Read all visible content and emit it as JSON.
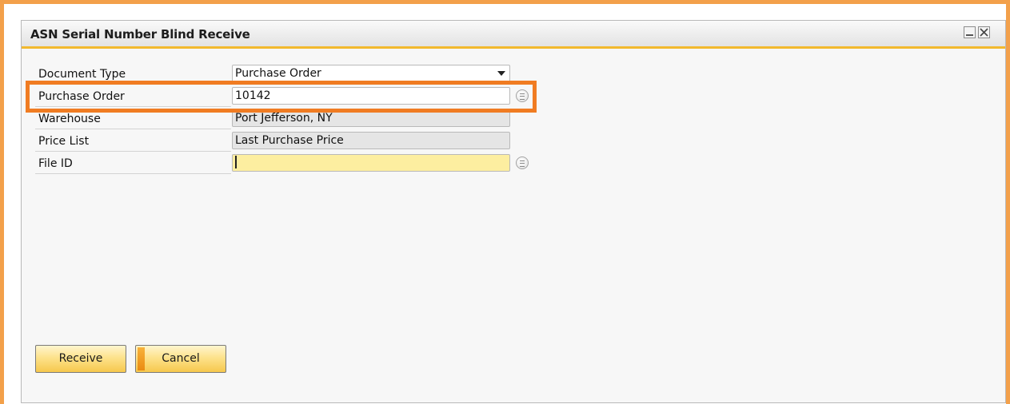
{
  "window": {
    "title": "ASN Serial Number Blind Receive"
  },
  "form": {
    "document_type": {
      "label": "Document Type",
      "value": "Purchase Order"
    },
    "purchase_order": {
      "label": "Purchase Order",
      "value": "10142"
    },
    "warehouse": {
      "label": "Warehouse",
      "value": "Port Jefferson, NY"
    },
    "price_list": {
      "label": "Price List",
      "value": "Last Purchase Price"
    },
    "file_id": {
      "label": "File ID",
      "value": ""
    }
  },
  "buttons": {
    "receive": "Receive",
    "cancel": "Cancel"
  },
  "colors": {
    "highlight": "#f07c22",
    "outer_frame": "#f3a04a",
    "title_accent": "#f2b92e",
    "active_field": "#fdeea0",
    "readonly_field": "#e5e5e5"
  },
  "icons": {
    "minimize": "minimize-icon",
    "close": "close-icon",
    "dropdown": "chevron-down-icon",
    "lookup": "list-lookup-icon"
  }
}
